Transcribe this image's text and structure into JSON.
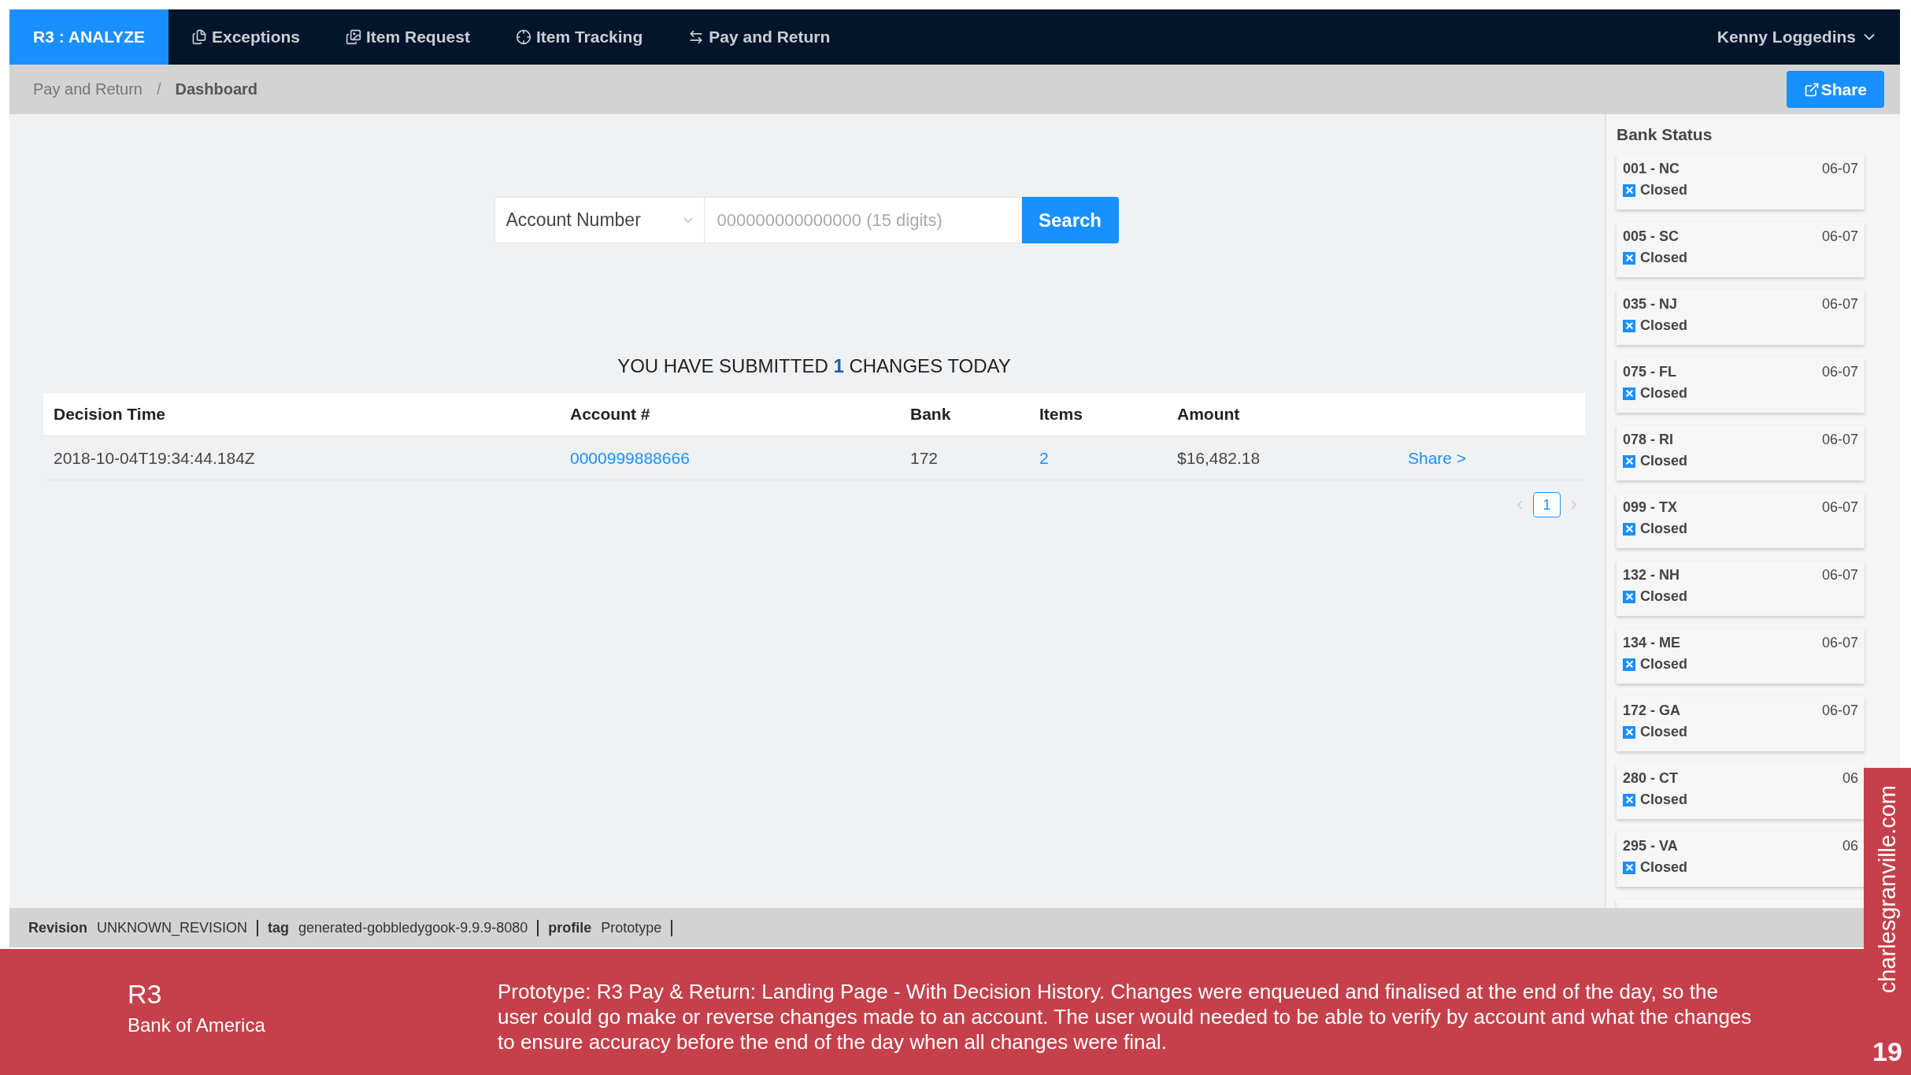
{
  "nav": {
    "brand": "R3 : ANALYZE",
    "items": [
      {
        "label": "Exceptions",
        "kind": "files",
        "selected": false
      },
      {
        "label": "Item Request",
        "kind": "images",
        "selected": false
      },
      {
        "label": "Item Tracking",
        "kind": "crosshair",
        "selected": false
      },
      {
        "label": "Pay and Return",
        "kind": "arrows",
        "selected": false
      }
    ],
    "user": "Kenny Loggedins"
  },
  "breadcrumb": {
    "items": [
      "Pay and Return",
      "Dashboard"
    ],
    "separator": "/",
    "share_button": "Share"
  },
  "search": {
    "type_select": "Account Number",
    "placeholder": "000000000000000 (15 digits)",
    "button": "Search"
  },
  "summary": "YOU HAVE SUBMITTED **1** CHANGES TODAY",
  "table": {
    "columns": [
      "Decision Time",
      "Account #",
      "Bank",
      "Items",
      "Amount"
    ],
    "rows": [
      {
        "decision_time": "2018-10-04T19:34:44.184Z",
        "account": "0000999888666",
        "bank": "172",
        "items": "2",
        "amount": "$16,482.18",
        "action": "Share >"
      }
    ]
  },
  "pagination": {
    "pages": [
      {
        "label": "1",
        "selected": true
      }
    ]
  },
  "bank_status": {
    "title": "Bank Status",
    "banks": [
      {
        "name": "001 - NC",
        "date": "06-07",
        "status": "Closed"
      },
      {
        "name": "005 - SC",
        "date": "06-07",
        "status": "Closed"
      },
      {
        "name": "035 - NJ",
        "date": "06-07",
        "status": "Closed"
      },
      {
        "name": "075 - FL",
        "date": "06-07",
        "status": "Closed"
      },
      {
        "name": "078 - RI",
        "date": "06-07",
        "status": "Closed"
      },
      {
        "name": "099 - TX",
        "date": "06-07",
        "status": "Closed"
      },
      {
        "name": "132 - NH",
        "date": "06-07",
        "status": "Closed"
      },
      {
        "name": "134 - ME",
        "date": "06-07",
        "status": "Closed"
      },
      {
        "name": "172 - GA",
        "date": "06-07",
        "status": "Closed"
      },
      {
        "name": "280 - CT",
        "date": "06",
        "status": "Closed"
      },
      {
        "name": "295 - VA",
        "date": "06",
        "status": "Closed"
      }
    ]
  },
  "status_bar": [
    {
      "key": "Revision",
      "value": "UNKNOWN_REVISION"
    },
    {
      "key": "tag",
      "value": "generated-gobbledygook-9.9.9-8080"
    },
    {
      "key": "profile",
      "value": "Prototype"
    }
  ],
  "caption": {
    "title": "R3",
    "client": "Bank of America",
    "description": "Prototype: R3 Pay & Return: Landing Page - With Decision History. Changes were enqueued and finalised at the end of the day, so the user could go make or reverse changes made to an account. The user would needed to be able to verify by account and what the changes to ensure accuracy before the end of the day when all changes were final.",
    "site": "charlesgranville.com",
    "page_number": "19"
  }
}
